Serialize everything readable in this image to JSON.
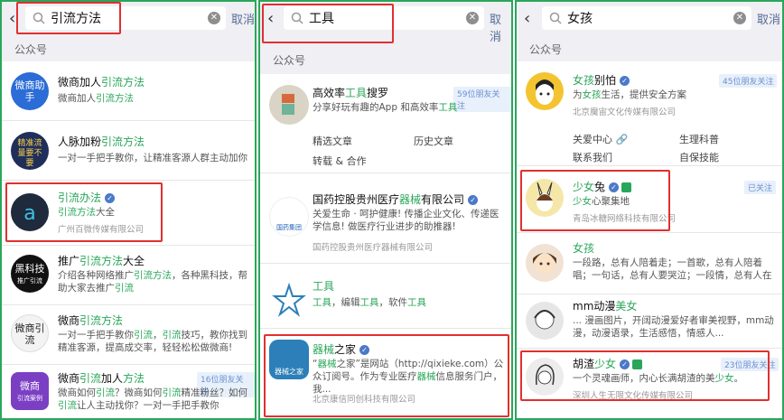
{
  "cancel": "取消",
  "section": "公众号",
  "p1": {
    "query": "引流方法",
    "items": [
      {
        "title_pre": "微商加人",
        "title_hl": "引流方法",
        "desc_pre": "微商加人",
        "desc_hl": "引流方法",
        "avatar_text": "微商助手",
        "avatar_color": "#2b6cd6"
      },
      {
        "title_pre": "人脉加粉",
        "title_hl": "引流方法",
        "desc": "一对一手把手教你，让精准客源人群主动加你",
        "avatar_text": "精准流量要不要",
        "avatar_color": "#1f2f5a"
      },
      {
        "title_hl": "引流办法",
        "desc_hl": "引流方法",
        "desc_post": "大全",
        "meta": "广州百微传媒有限公司",
        "avatar_color": "#1f2a3d"
      },
      {
        "title_pre": "推广",
        "title_hl": "引流方法",
        "title_post": "大全",
        "desc_a": "介绍各种网络推广",
        "desc_b": "引流方法",
        "desc_c": "，各种黑科技，帮",
        "desc_d": "助大家去推广",
        "desc_e": "引流",
        "avatar_text": "黑科技",
        "avatar_sub": "推广引流"
      },
      {
        "title_pre": "微商",
        "title_hl": "引流方法",
        "desc_a": "一对一手把手教你",
        "desc_b": "引流",
        "desc_c": "，",
        "desc_d": "引流",
        "desc_e": "技巧，教你找到精准客源",
        "desc_f": "，提高成交率，轻轻松松做微商!",
        "avatar_text": "微商引流"
      },
      {
        "title_pre": "微商",
        "title_hl": "引流",
        "title_mid": "加人",
        "title_hl2": "方法",
        "desc_a": "微商如何",
        "desc_b": "引流",
        "desc_c": "？微商如何",
        "desc_d": "引流",
        "desc_e": "精准粉丝？如何",
        "desc_f": "引流",
        "desc_g": "让人主动找你？一对一手把手教你",
        "tag": "16位朋友关注",
        "avatar_text": "微商",
        "avatar_sub": "引流案例",
        "avatar_color": "#7b3fc4"
      }
    ]
  },
  "p2": {
    "query": "工具",
    "items": [
      {
        "title_pre": "高效率",
        "title_hl": "工具",
        "title_post": "搜罗",
        "desc_pre": "分享好玩有趣的App 和高效率",
        "desc_hl": "工具",
        "tag": "59位朋友关注",
        "links": [
          "精选文章",
          "历史文章",
          "转载 & 合作"
        ]
      },
      {
        "title_pre": "国药控股贵州医疗",
        "title_hl": "器械",
        "title_post": "有限公司",
        "desc": "关爱生命 · 呵护健康! 传播企业文化、传递医学信息! 做医疗行业进步的助推器!",
        "meta": "国药控股贵州医疗器械有限公司",
        "avatar_text": "国药集团"
      },
      {
        "title_hl": "工具",
        "desc_a": "工具",
        "desc_b": "，编辑",
        "desc_c": "工具",
        "desc_d": "，软件",
        "desc_e": "工具"
      },
      {
        "title_hl": "器械",
        "title_post": "之家",
        "desc_a": "“",
        "desc_b": "器械",
        "desc_c": "之家”是网站（http://qixieke.com）公众订阅号。作为专业医疗",
        "desc_d": "器械",
        "desc_e": "信息服务门户，我...",
        "meta": "北京康信同创科技有限公司",
        "avatar_text": "器械之家",
        "avatar_color": "#2c7fb8"
      }
    ]
  },
  "p3": {
    "query": "女孩",
    "items": [
      {
        "title_hl": "女孩",
        "title_post": "别怕",
        "desc_pre": "为",
        "desc_hl": "女孩",
        "desc_post": "生活，提供安全方案",
        "meta": "北京魔宙文化传媒有限公司",
        "tag": "45位朋友关注",
        "links": [
          "关爱中心",
          "生理科普",
          "联系我们",
          "自保技能"
        ]
      },
      {
        "title_hl": "少女",
        "title_post": "兔",
        "desc_hl": "少女",
        "desc_post": "心聚集地",
        "meta": "青岛冰糖网络科技有限公司",
        "tag": "已关注"
      },
      {
        "title_hl": "女孩",
        "desc": "一段路，总有人陪着走；一首歌，总有人陪着唱；一句话，总有人要哭泣；一段情，总有人在"
      },
      {
        "title_pre": "mm动漫",
        "title_hl": "美女",
        "desc": "... 漫画图片，开阔动漫爱好者审美视野，mm动漫，动漫语录，生活感悟，情感人..."
      },
      {
        "title_pre": "胡渣",
        "title_hl": "少女",
        "desc_pre": "一个灵魂画师，内心长满胡渣的美",
        "desc_hl": "少女",
        "desc_post": "。",
        "meta": "深圳人生无限文化传媒有限公司",
        "tag": "23位朋友关注"
      }
    ]
  },
  "colors": {
    "accent": "#2aa65a",
    "link": "#576b95",
    "highlight_box": "#e03030"
  }
}
